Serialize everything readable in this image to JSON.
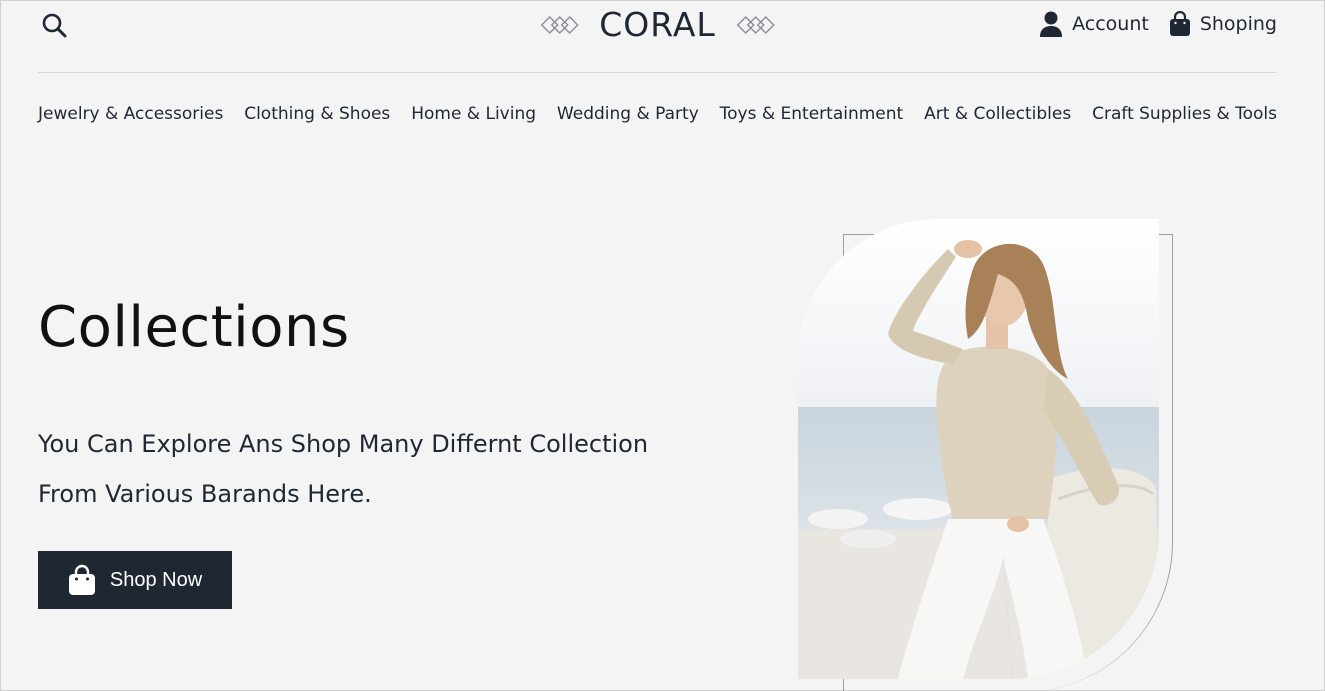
{
  "brand": {
    "name": "CORAL"
  },
  "header": {
    "account_label": "Account",
    "shopping_label": "Shoping"
  },
  "nav": {
    "items": [
      "Jewelry & Accessories",
      "Clothing & Shoes",
      "Home & Living",
      "Wedding & Party",
      "Toys & Entertainment",
      "Art & Collectibles",
      "Craft Supplies & Tools"
    ]
  },
  "hero": {
    "title": "Collections",
    "text_line1": "You Can Explore Ans Shop Many Differnt Collection",
    "text_line2": "From Various Barands Here.",
    "button_label": "Shop Now"
  },
  "colors": {
    "background": "#f4f4f4",
    "text": "#1f2732",
    "button_bg": "#1f2732",
    "button_text": "#ffffff"
  },
  "icons": [
    "search-icon",
    "logo-ornament-icon",
    "user-icon",
    "shopping-bag-icon"
  ]
}
